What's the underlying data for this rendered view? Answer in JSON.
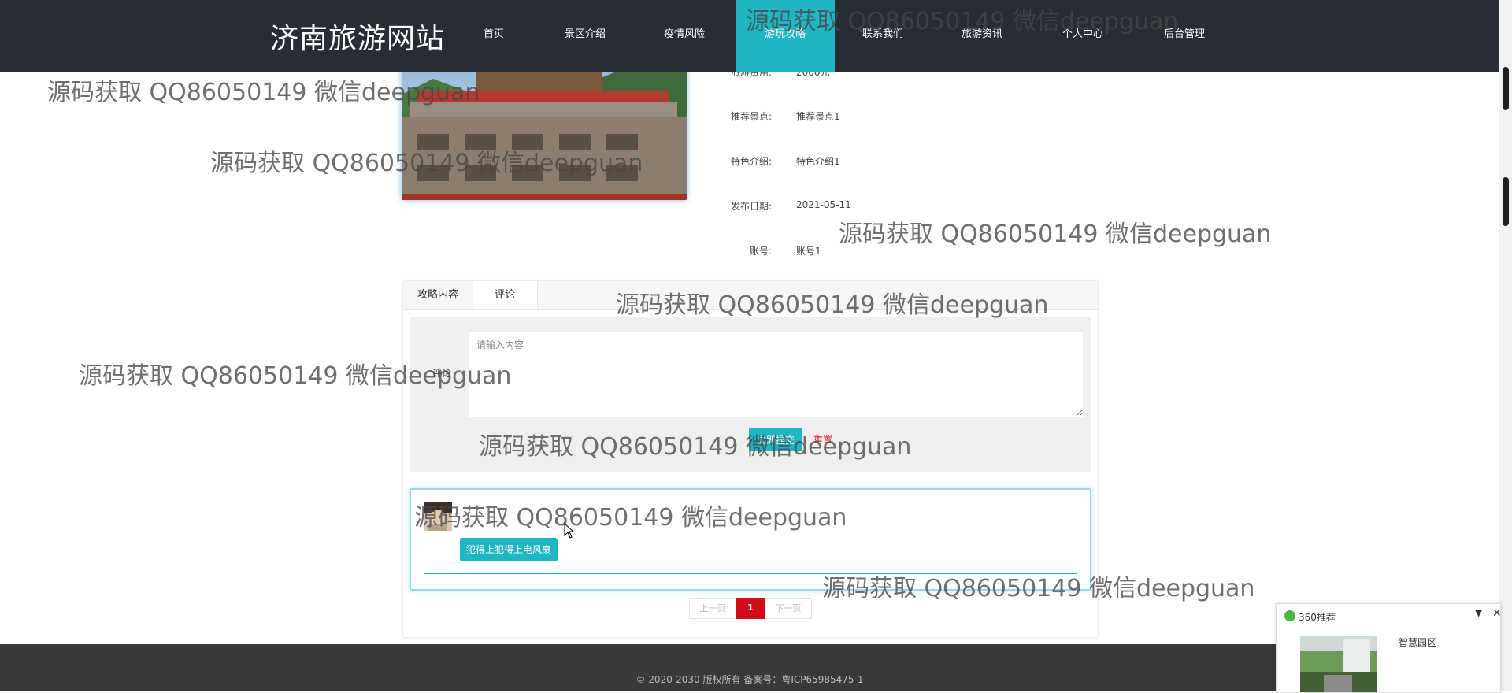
{
  "header": {
    "site_title": "济南旅游网站",
    "nav": [
      "首页",
      "景区介绍",
      "疫情风险",
      "游玩攻略",
      "联系我们",
      "旅游资讯",
      "个人中心",
      "后台管理"
    ],
    "active_nav": "游玩攻略"
  },
  "detail": {
    "rows": [
      {
        "label": "旅游费用:",
        "value": "2000元"
      },
      {
        "label": "推荐景点:",
        "value": "推荐景点1"
      },
      {
        "label": "特色介绍:",
        "value": "特色介绍1"
      },
      {
        "label": "发布日期:",
        "value": "2021-05-11"
      },
      {
        "label": "账号:",
        "value": "账号1"
      }
    ]
  },
  "tabs": {
    "content": "攻略内容",
    "comment": "评论"
  },
  "comment_form": {
    "label": "评论",
    "placeholder": "请输入内容",
    "submit": "立即提交",
    "reset": "重置"
  },
  "comments": [
    {
      "text": "犯得上犯得上电风扇"
    }
  ],
  "pagination": {
    "prev": "上一页",
    "current": "1",
    "next": "下一页"
  },
  "footer": {
    "copyright": "© 2020-2030 版权所有 备案号：粤ICP65985475-1"
  },
  "popup": {
    "title": "360推荐",
    "item_title": "智慧园区"
  },
  "watermark_text": "源码获取 QQ86050149 微信deepguan",
  "colors": {
    "header_bg": "#282c35",
    "accent": "#1fb5c3",
    "pager_active": "#d10b17",
    "footer_bg": "#393939"
  }
}
